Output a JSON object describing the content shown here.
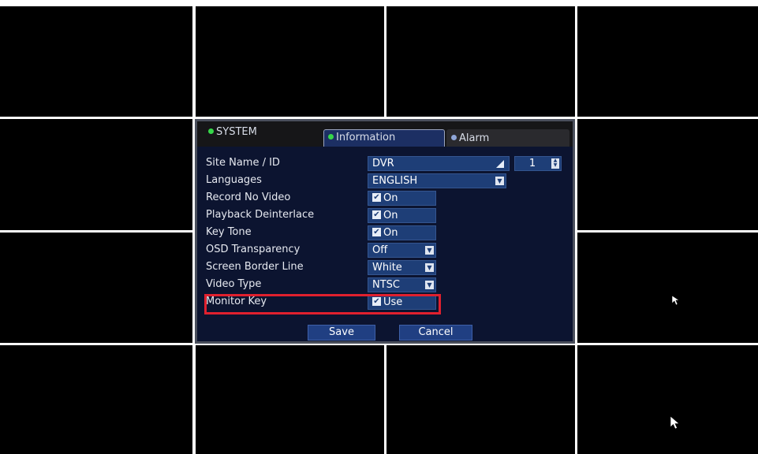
{
  "dialog": {
    "system_tab": "SYSTEM",
    "tabs": [
      {
        "label": "Information",
        "active": true
      },
      {
        "label": "Alarm",
        "active": false
      }
    ],
    "site": {
      "label": "Site Name / ID",
      "value": "DVR",
      "id": "1"
    },
    "languages": {
      "label": "Languages",
      "value": "ENGLISH"
    },
    "record_no_video": {
      "label": "Record No Video",
      "value": "On",
      "checked": true
    },
    "playback_deinterlace": {
      "label": "Playback Deinterlace",
      "value": "On",
      "checked": true
    },
    "key_tone": {
      "label": "Key Tone",
      "value": "On",
      "checked": true
    },
    "osd_transparency": {
      "label": "OSD Transparency",
      "value": "Off"
    },
    "screen_border_line": {
      "label": "Screen Border Line",
      "value": "White"
    },
    "video_type": {
      "label": "Video Type",
      "value": "NTSC"
    },
    "monitor_key": {
      "label": "Monitor Key",
      "value": "Use",
      "checked": true
    },
    "save_label": "Save",
    "cancel_label": "Cancel"
  },
  "colors": {
    "dialog_bg": "#0c1430",
    "field_bg": "#1e3e77",
    "highlight": "#e0202e",
    "status_dot_green": "#36d64a"
  },
  "icons": {
    "cursor": "mouse-pointer-icon",
    "checkbox": "checkmark-icon",
    "dropdown": "chevron-down-icon",
    "spinner": "spin-arrows-icon"
  }
}
